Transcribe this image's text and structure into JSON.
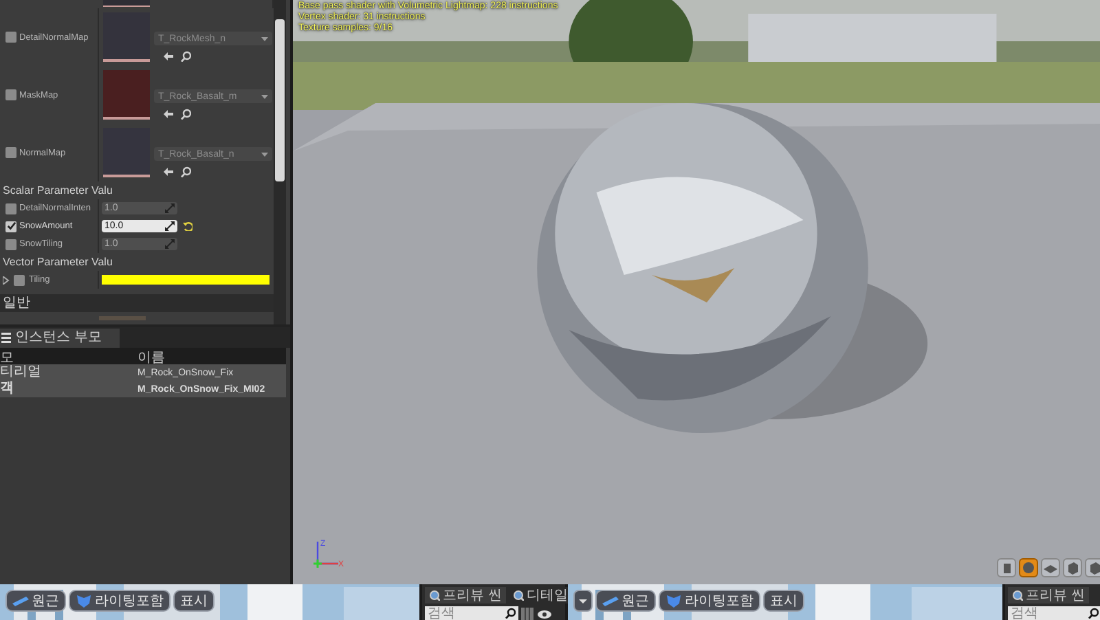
{
  "details": {
    "texture_parameters": [
      {
        "label": "DetailNormalMap",
        "texture": "T_RockMesh_n",
        "checked": false,
        "color": "#34333d"
      },
      {
        "label": "MaskMap",
        "texture": "T_Rock_Basalt_m",
        "checked": false,
        "color": "#4a1f20"
      },
      {
        "label": "NormalMap",
        "texture": "T_Rock_Basalt_n",
        "checked": false,
        "color": "#35343f"
      }
    ],
    "scalar_header": "Scalar Parameter Valu",
    "scalar_parameters": [
      {
        "label": "DetailNormalInten",
        "value": "1.0",
        "checked": false,
        "modified": false
      },
      {
        "label": "SnowAmount",
        "value": "10.0",
        "checked": true,
        "modified": true
      },
      {
        "label": "SnowTiling",
        "value": "1.0",
        "checked": false,
        "modified": false
      }
    ],
    "vector_header": "Vector Parameter Valu",
    "vector_parameters": [
      {
        "label": "Tiling",
        "checked": false,
        "color": "#ffff00"
      }
    ],
    "section": "일반"
  },
  "instance_panel": {
    "tab": "인스턴스 부모",
    "columns": [
      "모",
      "이름"
    ],
    "rows": [
      {
        "cells": [
          "티리얼",
          "M_Rock_OnSnow_Fix"
        ],
        "current": false
      },
      {
        "cells": [
          "객",
          "M_Rock_OnSnow_Fix_MI02"
        ],
        "current": true
      }
    ]
  },
  "viewport": {
    "stats": [
      "Base pass shader with Volumetric Lightmap: 228 instructions",
      "Vertex shader: 31 instructions",
      "Texture samples: 9/16"
    ],
    "axis_labels": [
      "Z",
      "X"
    ],
    "view_buttons": [
      {
        "kind": "cylinder",
        "selected": false
      },
      {
        "kind": "sphere",
        "selected": true
      },
      {
        "kind": "plane",
        "selected": false
      },
      {
        "kind": "cube",
        "selected": false
      },
      {
        "kind": "cube",
        "selected": false
      }
    ]
  },
  "bottom": {
    "left_toolbar": {
      "buttons": [
        {
          "label": "원근",
          "kind": "perspective"
        },
        {
          "label": "라이팅포함",
          "kind": "lighting"
        },
        {
          "label": "표시",
          "kind": "plain"
        }
      ]
    },
    "left_panel": {
      "tabs": [
        {
          "label": "프리뷰 씬",
          "selected": true
        },
        {
          "label": "디테일",
          "selected": false
        }
      ],
      "search": {
        "placeholder": "검색"
      }
    },
    "right_toolbar": {
      "dropdown": true,
      "buttons": [
        {
          "label": "원근",
          "kind": "perspective"
        },
        {
          "label": "라이팅포함",
          "kind": "lighting"
        },
        {
          "label": "표시",
          "kind": "plain"
        }
      ]
    },
    "right_panel": {
      "tabs": [
        {
          "label": "프리뷰 씬",
          "selected": true
        }
      ],
      "search": {
        "placeholder": "검색"
      }
    }
  }
}
